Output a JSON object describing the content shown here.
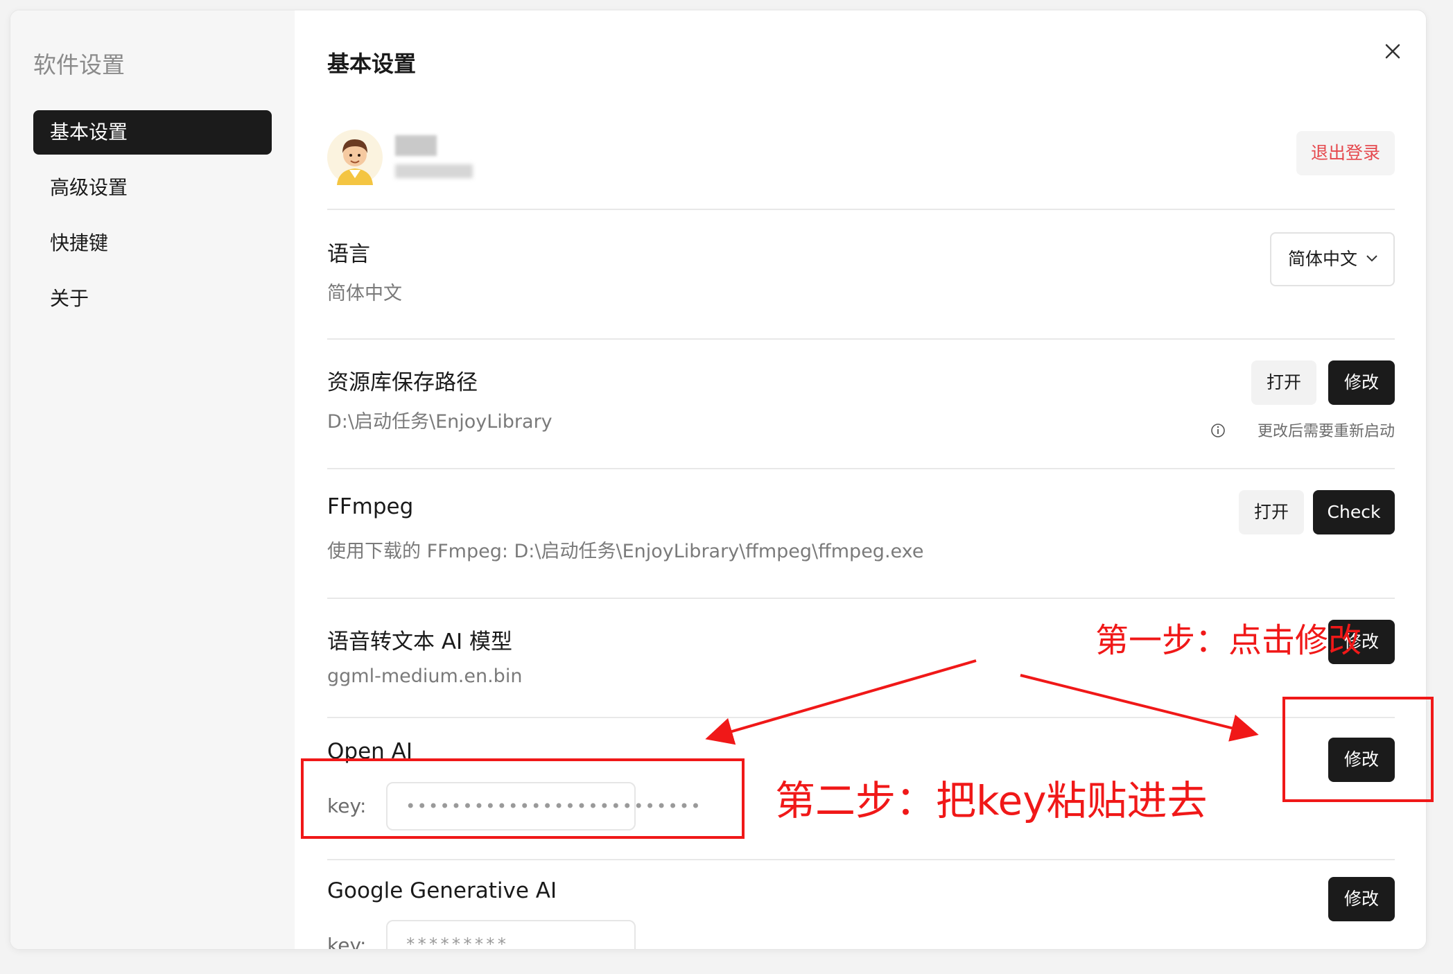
{
  "sidebar": {
    "title": "软件设置",
    "items": [
      {
        "label": "基本设置",
        "active": true
      },
      {
        "label": "高级设置",
        "active": false
      },
      {
        "label": "快捷键",
        "active": false
      },
      {
        "label": "关于",
        "active": false
      }
    ]
  },
  "main": {
    "title": "基本设置",
    "account": {
      "logout_label": "退出登录"
    },
    "language": {
      "label": "语言",
      "value": "简体中文",
      "select_value": "简体中文"
    },
    "library": {
      "label": "资源库保存路径",
      "value": "D:\\启动任务\\EnjoyLibrary",
      "open_label": "打开",
      "modify_label": "修改",
      "note": "更改后需要重新启动"
    },
    "ffmpeg": {
      "label": "FFmpeg",
      "value": "使用下载的 FFmpeg: D:\\启动任务\\EnjoyLibrary\\ffmpeg\\ffmpeg.exe",
      "open_label": "打开",
      "check_label": "Check"
    },
    "stt_model": {
      "label": "语音转文本 AI 模型",
      "value": "ggml-medium.en.bin",
      "modify_label": "修改"
    },
    "openai": {
      "label": "Open AI",
      "key_label": "key:",
      "key_value": "••••••••••••••••••••••••••",
      "modify_label": "修改"
    },
    "google": {
      "label": "Google Generative AI",
      "key_label": "key:",
      "key_value": "*********",
      "modify_label": "修改"
    }
  },
  "annotations": {
    "step1": "第一步：点击修改",
    "step2": "第二步：把key粘贴进去",
    "color": "#f01818"
  },
  "colors": {
    "accent_dark": "#1b1b1b",
    "danger": "#e5484d"
  }
}
